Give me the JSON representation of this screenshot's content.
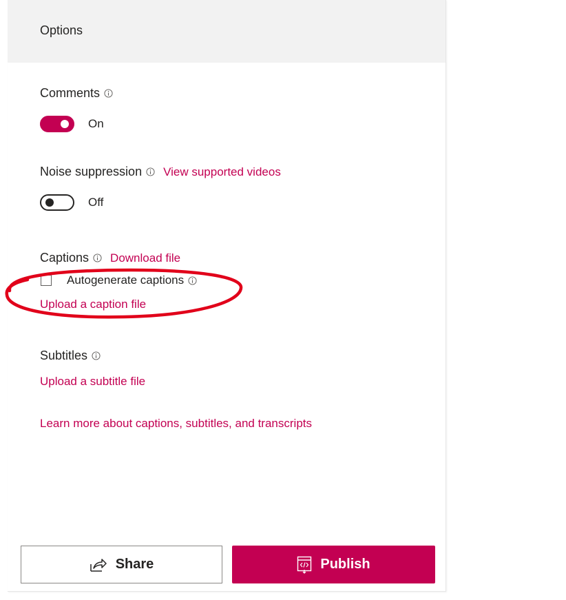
{
  "panel": {
    "title": "Options"
  },
  "comments": {
    "label": "Comments",
    "state": "On"
  },
  "noise": {
    "label": "Noise suppression",
    "link": "View supported videos",
    "state": "Off"
  },
  "captions": {
    "label": "Captions",
    "download_link": "Download file",
    "autogenerate_label": "Autogenerate captions",
    "upload_link": "Upload a caption file"
  },
  "subtitles": {
    "label": "Subtitles",
    "upload_link": "Upload a subtitle file"
  },
  "learn_more": "Learn more about captions, subtitles, and transcripts",
  "buttons": {
    "share": "Share",
    "publish": "Publish"
  },
  "colors": {
    "accent": "#c30052",
    "annotation": "#e1001a"
  }
}
